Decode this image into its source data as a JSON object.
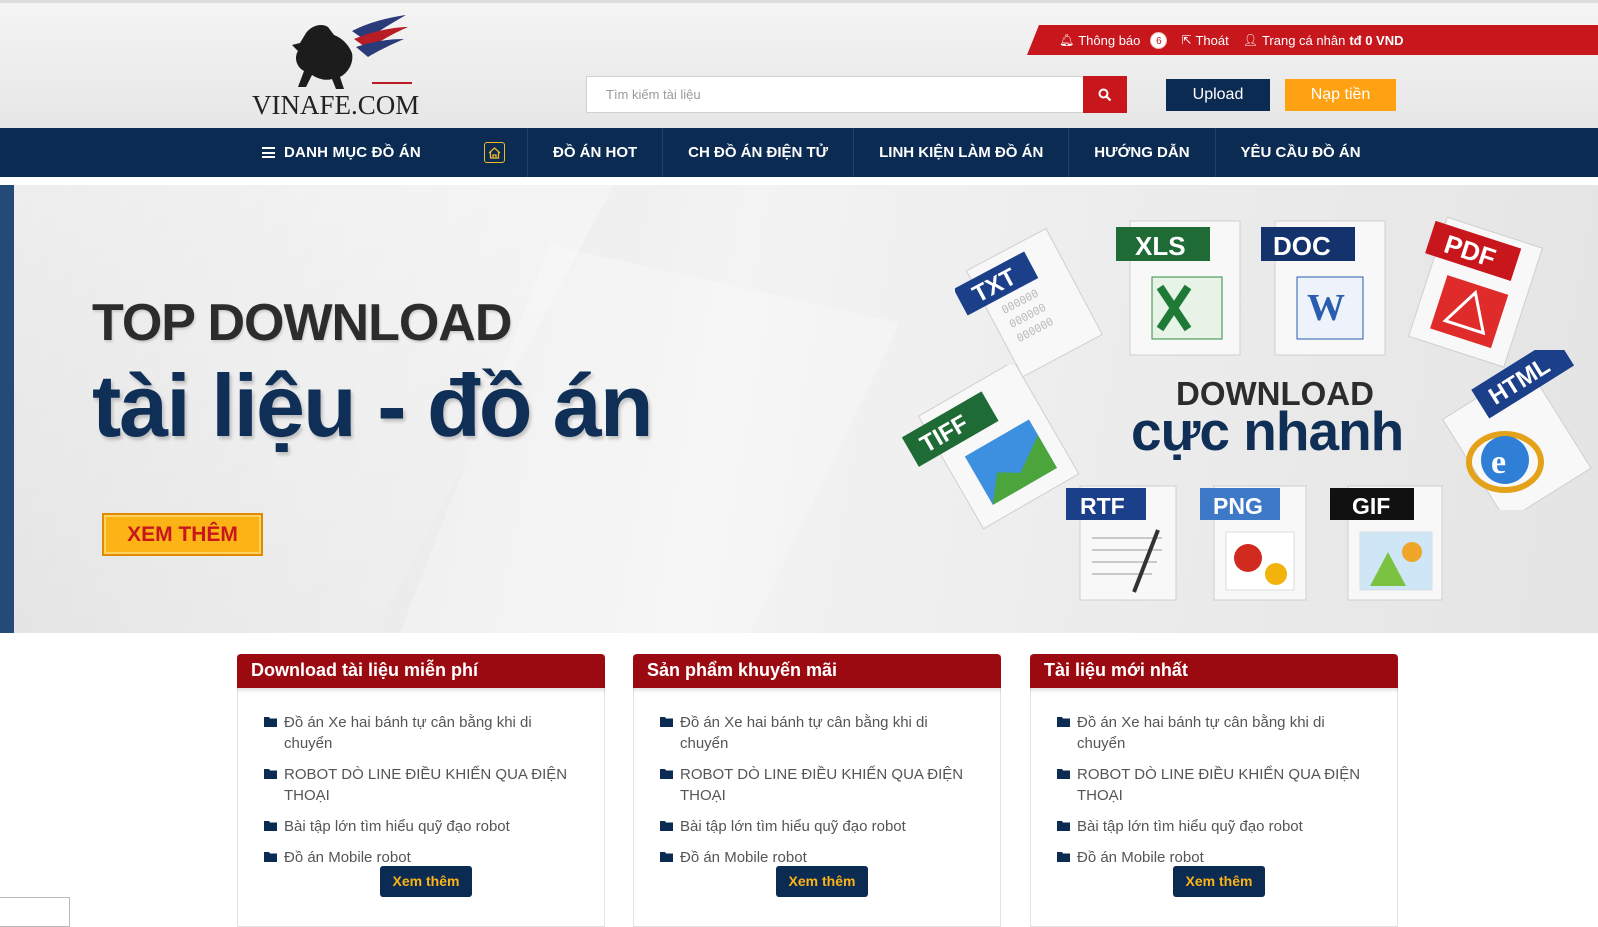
{
  "logo": {
    "text": "VINAFE.COM"
  },
  "topbar": {
    "notifications_label": "Thông báo",
    "notifications_count": "6",
    "logout_label": "Thoát",
    "profile_label": "Trang cá nhân",
    "balance": "tđ 0 VND"
  },
  "search": {
    "placeholder": "Tìm kiếm tài liệu"
  },
  "actions": {
    "upload_label": "Upload",
    "topup_label": "Nạp tiền"
  },
  "nav": {
    "category_label": "DANH MỤC ĐỒ ÁN",
    "items": [
      {
        "label": "ĐỒ ÁN HOT"
      },
      {
        "label": "CH ĐỒ ÁN ĐIỆN TỬ"
      },
      {
        "label": "LINH KIỆN LÀM ĐỒ ÁN"
      },
      {
        "label": "HƯỚNG DẪN"
      },
      {
        "label": "YÊU CẦU ĐỒ ÁN"
      }
    ]
  },
  "banner": {
    "headline_top": "TOP DOWNLOAD",
    "headline_main": "tài liệu - đồ án",
    "cta_label": "XEM THÊM",
    "right_top": "DOWNLOAD",
    "right_main": "cực nhanh",
    "file_types": [
      "TXT",
      "XLS",
      "DOC",
      "PDF",
      "TIFF",
      "HTML",
      "RTF",
      "PNG",
      "GIF"
    ]
  },
  "colors": {
    "navy": "#0b2b52",
    "red": "#c8161d",
    "dark_red": "#9b0a11",
    "orange": "#fea113"
  },
  "boxes": [
    {
      "title": "Download tài liệu miễn phí",
      "items": [
        "Đồ án Xe hai bánh tự cân bằng khi di chuyển",
        "ROBOT DÒ LINE ĐIỀU KHIỂN QUA ĐIỆN THOẠI",
        "Bài tập lớn tìm hiểu quỹ đạo robot",
        "Đồ án Mobile robot"
      ],
      "more_label": "Xem thêm"
    },
    {
      "title": "Sản phẩm khuyến mãi",
      "items": [
        "Đồ án Xe hai bánh tự cân bằng khi di chuyển",
        "ROBOT DÒ LINE ĐIỀU KHIỂN QUA ĐIỆN THOẠI",
        "Bài tập lớn tìm hiểu quỹ đạo robot",
        "Đồ án Mobile robot"
      ],
      "more_label": "Xem thêm"
    },
    {
      "title": "Tài liệu mới nhất",
      "items": [
        "Đồ án Xe hai bánh tự cân bằng khi di chuyển",
        "ROBOT DÒ LINE ĐIỀU KHIỂN QUA ĐIỆN THOẠI",
        "Bài tập lớn tìm hiểu quỹ đạo robot",
        "Đồ án Mobile robot"
      ],
      "more_label": "Xem thêm"
    }
  ]
}
